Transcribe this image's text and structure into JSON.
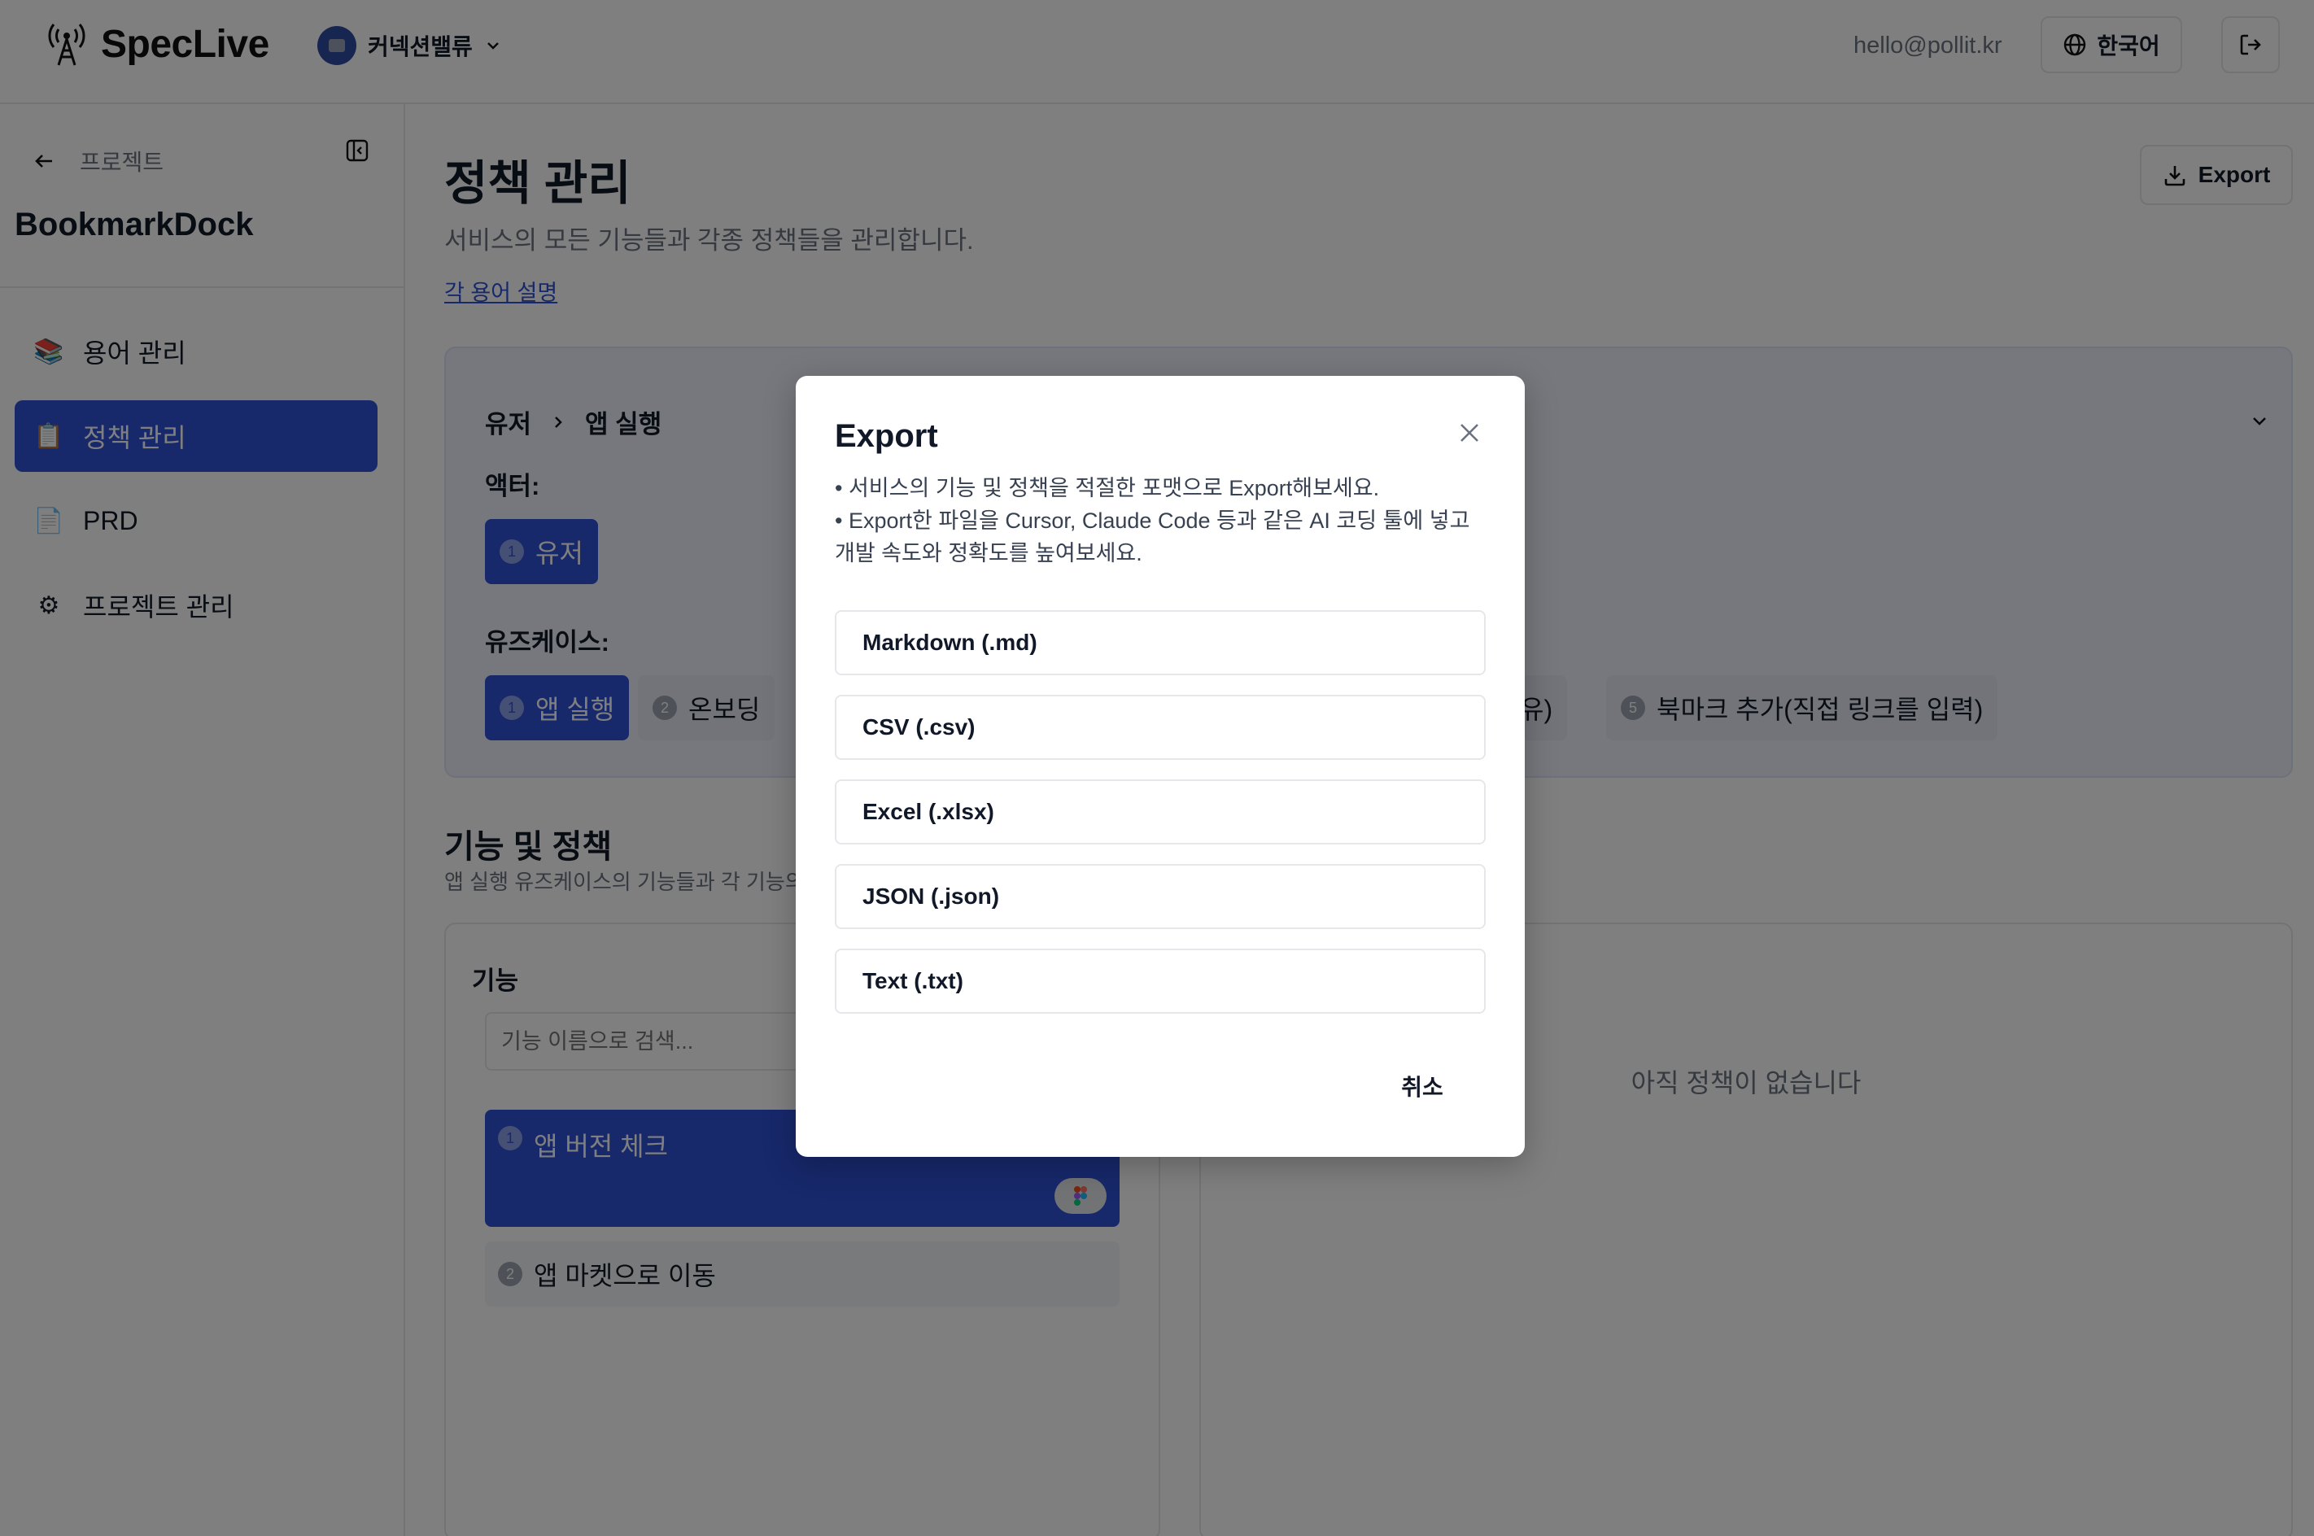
{
  "header": {
    "app_name": "SpecLive",
    "org_name": "커넥션밸류",
    "user_email": "hello@pollit.kr",
    "language": "한국어",
    "brand_color": "#2e50d6"
  },
  "sidebar": {
    "back_label": "프로젝트",
    "project_name": "BookmarkDock",
    "items": [
      {
        "label": "용어 관리",
        "icon": "books-icon"
      },
      {
        "label": "정책 관리",
        "icon": "clipboard-icon"
      },
      {
        "label": "PRD",
        "icon": "document-icon"
      },
      {
        "label": "프로젝트 관리",
        "icon": "gear-icon"
      }
    ],
    "active_index": 1
  },
  "main": {
    "title": "정책 관리",
    "subtitle": "서비스의 모든 기능들과 각종 정책들을 관리합니다.",
    "term_link": "각 용어 설명",
    "export_label": "Export",
    "breadcrumb": [
      "유저",
      "앱 실행"
    ],
    "actor_label": "액터:",
    "actor_chip": {
      "num": "1",
      "label": "유저"
    },
    "usecase_label": "유즈케이스:",
    "usecases": [
      {
        "num": "1",
        "label": "앱 실행"
      },
      {
        "num": "2",
        "label": "온보딩"
      },
      {
        "num": "",
        "label": "유)"
      },
      {
        "num": "5",
        "label": "북마크 추가(직접 링크를 입력)"
      }
    ],
    "features_title": "기능 및 정책",
    "features_sub": "앱 실행 유즈케이스의 기능들과 각 기능의",
    "features_heading": "기능",
    "search_placeholder": "기능 이름으로 검색...",
    "feature_items": [
      {
        "num": "1",
        "label": "앱 버전 체크"
      },
      {
        "num": "2",
        "label": "앱 마켓으로 이동"
      }
    ],
    "empty_policy": "아직 정책이 없습니다"
  },
  "modal": {
    "title": "Export",
    "desc_line1": "• 서비스의 기능 및 정책을 적절한 포맷으로 Export해보세요.",
    "desc_line2": "• Export한 파일을 Cursor, Claude Code 등과 같은 AI 코딩 툴에 넣고 개발 속도와 정확도를 높여보세요.",
    "formats": [
      "Markdown (.md)",
      "CSV (.csv)",
      "Excel (.xlsx)",
      "JSON (.json)",
      "Text (.txt)"
    ],
    "cancel_label": "취소"
  }
}
